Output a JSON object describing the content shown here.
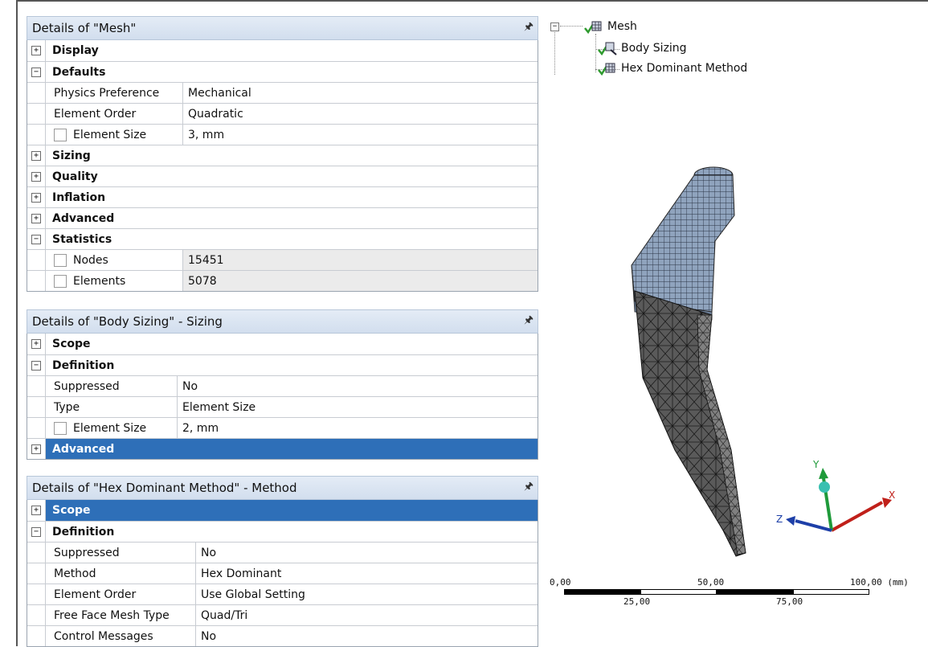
{
  "mesh_panel": {
    "title": "Details of \"Mesh\"",
    "pin_icon": "pin-icon",
    "rows": {
      "display": "Display",
      "defaults": "Defaults",
      "physics_pref_label": "Physics Preference",
      "physics_pref_value": "Mechanical",
      "element_order_label": "Element Order",
      "element_order_value": "Quadratic",
      "element_size_label": "Element Size",
      "element_size_value": "3, mm",
      "sizing": "Sizing",
      "quality": "Quality",
      "inflation": "Inflation",
      "advanced": "Advanced",
      "statistics": "Statistics",
      "nodes_label": "Nodes",
      "nodes_value": "15451",
      "elements_label": "Elements",
      "elements_value": "5078"
    }
  },
  "body_sizing_panel": {
    "title": "Details of \"Body Sizing\" - Sizing",
    "rows": {
      "scope": "Scope",
      "definition": "Definition",
      "suppressed_label": "Suppressed",
      "suppressed_value": "No",
      "type_label": "Type",
      "type_value": "Element Size",
      "element_size_label": "Element Size",
      "element_size_value": "2, mm",
      "advanced": "Advanced"
    }
  },
  "hex_panel": {
    "title": "Details of \"Hex Dominant Method\" - Method",
    "rows": {
      "scope": "Scope",
      "definition": "Definition",
      "suppressed_label": "Suppressed",
      "suppressed_value": "No",
      "method_label": "Method",
      "method_value": "Hex Dominant",
      "element_order_label": "Element Order",
      "element_order_value": "Use Global Setting",
      "free_face_label": "Free Face Mesh Type",
      "free_face_value": "Quad/Tri",
      "control_messages_label": "Control Messages",
      "control_messages_value": "No"
    }
  },
  "tree": {
    "root": "Mesh",
    "children": [
      "Body Sizing",
      "Hex Dominant Method"
    ]
  },
  "triad": {
    "x": "X",
    "y": "Y",
    "z": "Z",
    "colors": {
      "x": "#c0201a",
      "y": "#1f9a3a",
      "z": "#1d3fa8"
    }
  },
  "scale_bar": {
    "top_labels": [
      "0,00",
      "50,00",
      "100,00 (mm)"
    ],
    "bottom_labels": [
      "25,00",
      "75,00"
    ]
  },
  "colors": {
    "selection": "#2e6fb8",
    "header": "#d2deee",
    "check": "#2e9a2e"
  }
}
